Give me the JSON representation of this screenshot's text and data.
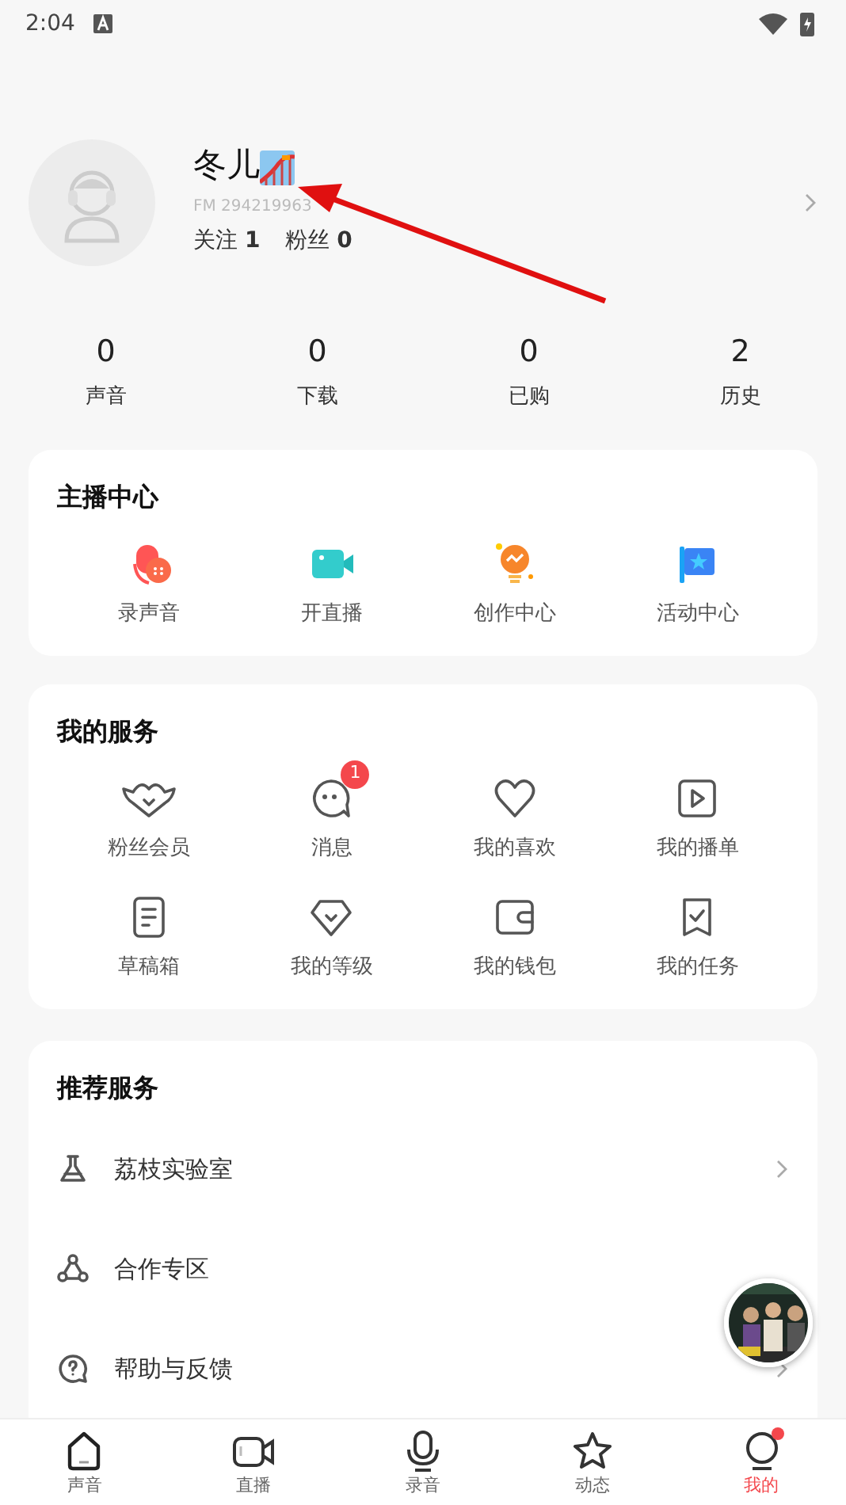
{
  "status_bar": {
    "time": "2:04"
  },
  "profile": {
    "name": "冬儿",
    "fm_id": "FM 294219963",
    "follow_label": "关注",
    "follow_count": "1",
    "fans_label": "粉丝",
    "fans_count": "0"
  },
  "stats": [
    {
      "value": "0",
      "label": "声音"
    },
    {
      "value": "0",
      "label": "下载"
    },
    {
      "value": "0",
      "label": "已购"
    },
    {
      "value": "2",
      "label": "历史"
    }
  ],
  "sections": [
    {
      "title": "主播中心",
      "kind": "grid",
      "items": [
        {
          "label": "录声音"
        },
        {
          "label": "开直播"
        },
        {
          "label": "创作中心"
        },
        {
          "label": "活动中心"
        }
      ]
    },
    {
      "title": "我的服务",
      "kind": "grid",
      "items": [
        {
          "label": "粉丝会员"
        },
        {
          "label": "消息",
          "badge": "1"
        },
        {
          "label": "我的喜欢"
        },
        {
          "label": "我的播单"
        },
        {
          "label": "草稿箱"
        },
        {
          "label": "我的等级"
        },
        {
          "label": "我的钱包"
        },
        {
          "label": "我的任务"
        }
      ]
    },
    {
      "title": "推荐服务",
      "kind": "list",
      "items": [
        {
          "label": "荔枝实验室"
        },
        {
          "label": "合作专区"
        },
        {
          "label": "帮助与反馈"
        }
      ]
    }
  ],
  "tabs": [
    {
      "label": "声音",
      "selected": false
    },
    {
      "label": "直播",
      "selected": false
    },
    {
      "label": "录音",
      "selected": false
    },
    {
      "label": "动态",
      "selected": false
    },
    {
      "label": "我的",
      "selected": true,
      "dot": true
    }
  ]
}
